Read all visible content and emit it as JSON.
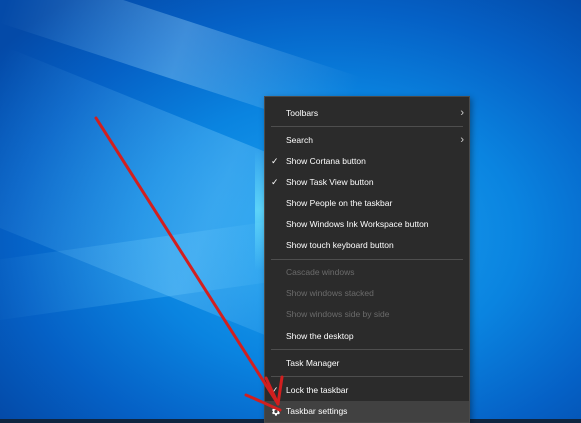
{
  "desktop": {
    "accent": "#0a84e0"
  },
  "context_menu": {
    "items": [
      {
        "label": "Toolbars",
        "submenu": true,
        "icon": "chevron-right-icon"
      },
      {
        "label": "Search",
        "submenu": true,
        "icon": "chevron-right-icon"
      },
      {
        "label": "Show Cortana button",
        "checked": true
      },
      {
        "label": "Show Task View button",
        "checked": true
      },
      {
        "label": "Show People on the taskbar"
      },
      {
        "label": "Show Windows Ink Workspace button"
      },
      {
        "label": "Show touch keyboard button"
      },
      {
        "label": "Cascade windows",
        "disabled": true
      },
      {
        "label": "Show windows stacked",
        "disabled": true
      },
      {
        "label": "Show windows side by side",
        "disabled": true
      },
      {
        "label": "Show the desktop"
      },
      {
        "label": "Task Manager"
      },
      {
        "label": "Lock the taskbar",
        "checked": true
      },
      {
        "label": "Taskbar settings",
        "icon": "gear-icon",
        "highlighted": true
      }
    ]
  },
  "annotation": {
    "arrow_color": "#d21f1f"
  }
}
